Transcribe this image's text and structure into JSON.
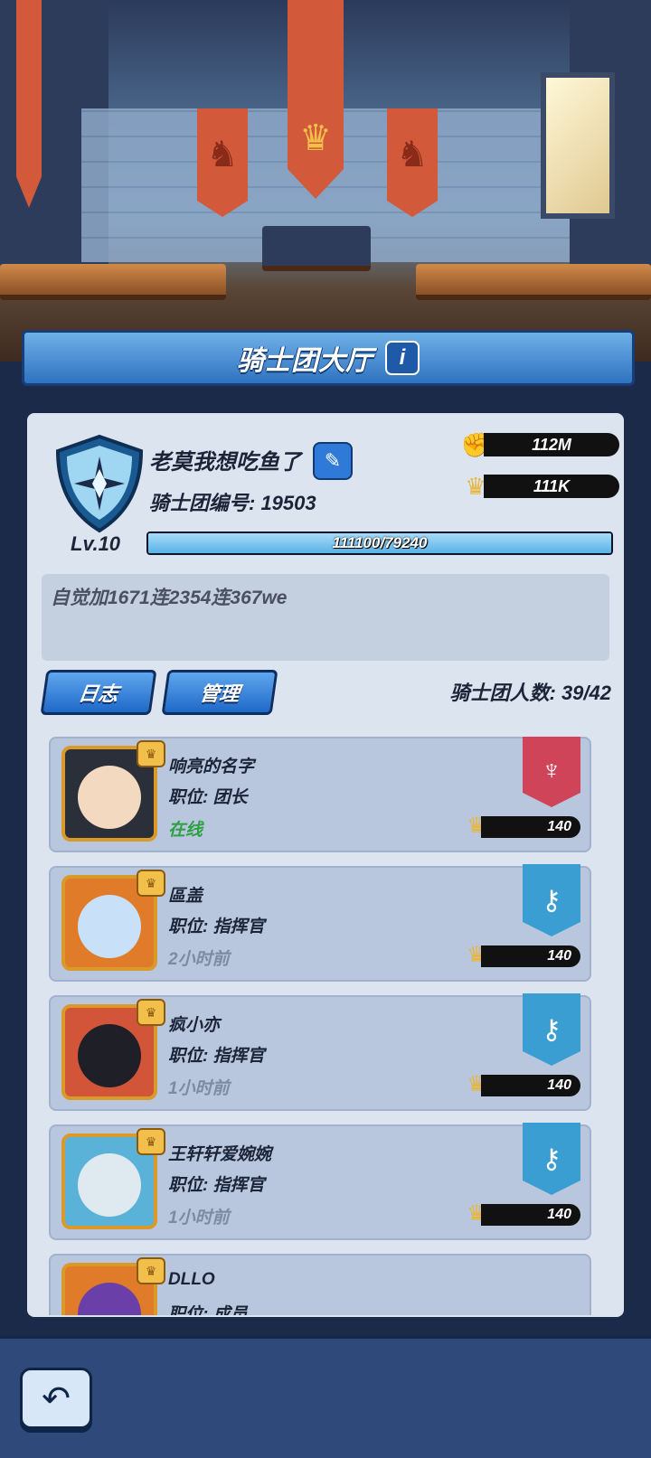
{
  "header": {
    "title": "骑士团大厅",
    "info_label": "i"
  },
  "guild": {
    "name": "老莫我想吃鱼了",
    "id_text": "骑士团编号: 19503",
    "power": "112M",
    "crown_score": "111K",
    "level": "Lv.10",
    "exp_text": "111100/79240",
    "exp_fraction": 1.0,
    "notice": "自觉加1671连2354连367we"
  },
  "tabs": {
    "log": "日志",
    "manage": "管理"
  },
  "member_count": "骑士团人数: 39/42",
  "members": [
    {
      "name": "响亮的名字",
      "position": "职位: 团长",
      "status": "在线",
      "level": "140",
      "role": "leader",
      "avatar_color": "#2b2f3a",
      "face_color": "#f3d9c0"
    },
    {
      "name": "區盖",
      "position": "职位: 指挥官",
      "status": "2小时前",
      "level": "140",
      "role": "commander",
      "avatar_color": "#e07b2a",
      "face_color": "#c8e0f8"
    },
    {
      "name": "疯小亦",
      "position": "职位: 指挥官",
      "status": "1小时前",
      "level": "140",
      "role": "commander",
      "avatar_color": "#d2553a",
      "face_color": "#1f1f28"
    },
    {
      "name": "王轩轩爱婉婉",
      "position": "职位: 指挥官",
      "status": "1小时前",
      "level": "140",
      "role": "commander",
      "avatar_color": "#5ab2d8",
      "face_color": "#dfe9f0"
    },
    {
      "name": "DLLO",
      "position": "职位: 成员",
      "status": "",
      "level": "",
      "role": "",
      "avatar_color": "#e07b2a",
      "face_color": "#6b3fa8"
    }
  ],
  "icons": {
    "power": "fist-icon",
    "crown": "crown-icon",
    "edit": "pencil-icon",
    "back": "back-arrow-icon",
    "leader_flag": "trident-banner-icon",
    "commander_flag": "key-banner-icon"
  }
}
